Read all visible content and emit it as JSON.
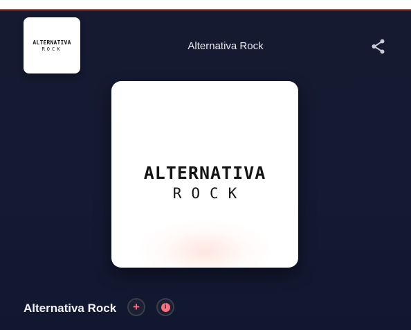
{
  "header": {
    "station_title": "Alternativa Rock",
    "logo_line1": "ALTERNATIVA",
    "logo_line2": "ROCK",
    "share_icon": "share-icon"
  },
  "cover": {
    "line1": "ALTERNATIVA",
    "line2": "ROCK"
  },
  "now_playing": {
    "title": "Alternativa Rock",
    "add_symbol": "+",
    "info_symbol": "i"
  },
  "colors": {
    "background": "#141a32",
    "accent": "#ff6f7d",
    "top_border": "#b94a3c"
  }
}
